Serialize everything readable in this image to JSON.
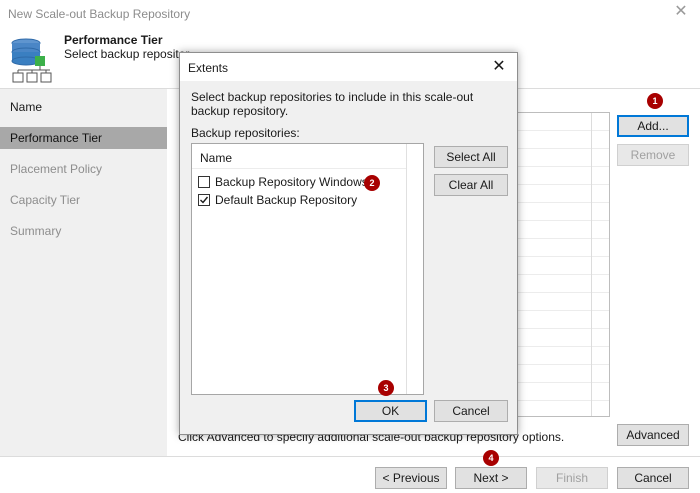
{
  "window": {
    "title": "New Scale-out Backup Repository",
    "close_glyph": "✕"
  },
  "header": {
    "title": "Performance Tier",
    "subtitle": "Select backup repositor",
    "icon": "repository-stack-icon"
  },
  "sidebar": {
    "items": [
      {
        "label": "Name",
        "state": "done"
      },
      {
        "label": "Performance Tier",
        "state": "active"
      },
      {
        "label": "Placement Policy",
        "state": "pending"
      },
      {
        "label": "Capacity Tier",
        "state": "pending"
      },
      {
        "label": "Summary",
        "state": "pending"
      }
    ]
  },
  "main": {
    "add_label": "Add...",
    "remove_label": "Remove",
    "advanced_note": "Click Advanced to specify additional scale-out backup repository options.",
    "advanced_label": "Advanced"
  },
  "footer": {
    "previous_label": "< Previous",
    "next_label": "Next >",
    "finish_label": "Finish",
    "cancel_label": "Cancel"
  },
  "dialog": {
    "title": "Extents",
    "close_glyph": "✕",
    "description": "Select backup repositories to include in this scale-out backup repository.",
    "list_label": "Backup repositories:",
    "column_header": "Name",
    "items": [
      {
        "label": "Backup Repository Windows",
        "checked": false
      },
      {
        "label": "Default Backup Repository",
        "checked": true
      }
    ],
    "select_all_label": "Select All",
    "clear_all_label": "Clear All",
    "ok_label": "OK",
    "cancel_label": "Cancel"
  },
  "badges": [
    "1",
    "2",
    "3",
    "4"
  ],
  "colors": {
    "badge": "#a80000",
    "active_nav": "#a8a8a8",
    "accent_border": "#0078d7",
    "icon_green": "#3cb04a",
    "icon_blue": "#3a7fc1"
  }
}
